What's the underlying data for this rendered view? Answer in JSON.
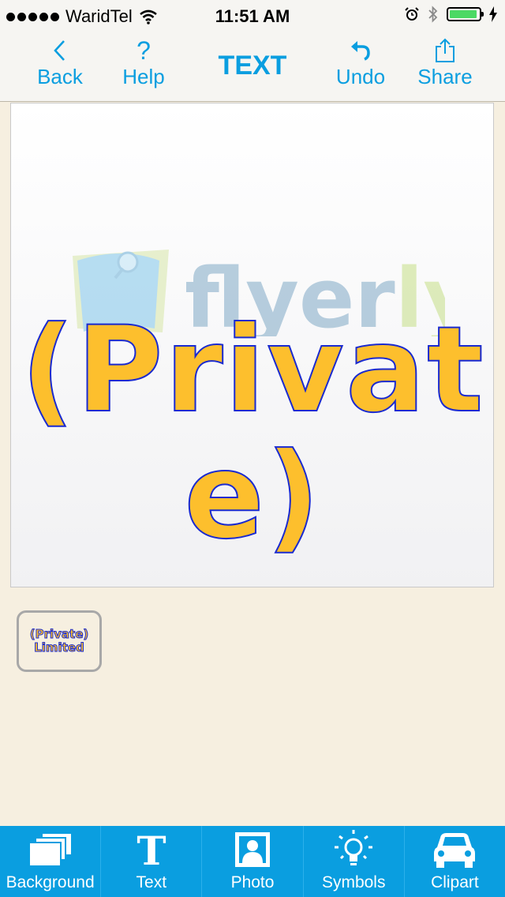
{
  "status_bar": {
    "carrier": "WaridTel",
    "time": "11:51 AM",
    "colors": {
      "battery": "#4cd964"
    }
  },
  "nav": {
    "back_label": "Back",
    "help_label": "Help",
    "title": "TEXT",
    "undo_label": "Undo",
    "share_label": "Share",
    "accent": "#0a9ee0"
  },
  "canvas": {
    "watermark": "flyerly",
    "text_line1": "(Privat",
    "text_line2": "e)",
    "text_fill": "#fdbf2d",
    "text_stroke": "#1a2ad0"
  },
  "thumbnail": {
    "line1": "(Private)",
    "line2": "Limited"
  },
  "tabs": [
    {
      "label": "Background",
      "icon": "layers-icon"
    },
    {
      "label": "Text",
      "icon": "text-t-icon"
    },
    {
      "label": "Photo",
      "icon": "photo-icon"
    },
    {
      "label": "Symbols",
      "icon": "lightbulb-icon"
    },
    {
      "label": "Clipart",
      "icon": "car-icon"
    }
  ]
}
